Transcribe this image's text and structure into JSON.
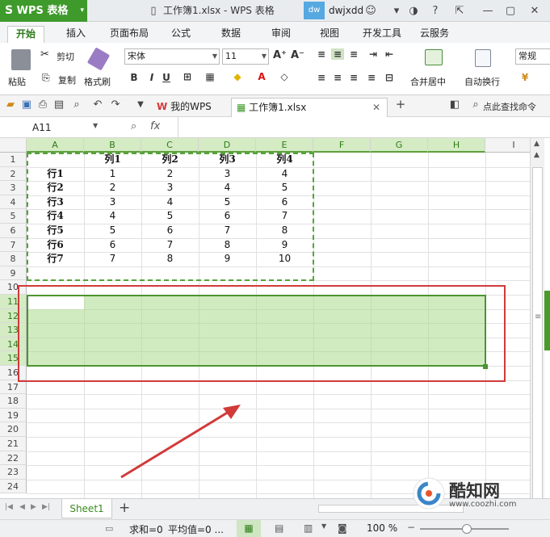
{
  "titlebar": {
    "app_label": "WPS 表格",
    "doc_title": "工作簿1.xlsx - WPS 表格",
    "avatar_text": "dw",
    "user_name": "dwjxdd"
  },
  "ribbon_tabs": [
    "开始",
    "插入",
    "页面布局",
    "公式",
    "数据",
    "审阅",
    "视图",
    "开发工具",
    "云服务"
  ],
  "ribbon": {
    "cut": "剪切",
    "paste": "粘贴",
    "copy": "复制",
    "format_painter": "格式刷",
    "font_name": "宋体",
    "font_size": "11",
    "merge_center": "合并居中",
    "wrap_text": "自动换行",
    "normal": "常规",
    "bold": "B",
    "italic": "I",
    "underline": "U"
  },
  "doc_tabs": {
    "wps_tab": "我的WPS",
    "file_tab": "工作簿1.xlsx",
    "search": "点此查找命令"
  },
  "formula_bar": {
    "name_box": "A11",
    "fx": "fx"
  },
  "columns": [
    "A",
    "B",
    "C",
    "D",
    "E",
    "F",
    "G",
    "H",
    "I"
  ],
  "rows": [
    "1",
    "2",
    "3",
    "4",
    "5",
    "6",
    "7",
    "8",
    "9",
    "10",
    "11",
    "12",
    "13",
    "14",
    "15",
    "16",
    "17",
    "18",
    "19",
    "20",
    "21",
    "22",
    "23",
    "24"
  ],
  "table": {
    "headers": [
      "列1",
      "列2",
      "列3",
      "列4"
    ],
    "rows": [
      {
        "label": "行1",
        "values": [
          "1",
          "2",
          "3",
          "4"
        ]
      },
      {
        "label": "行2",
        "values": [
          "2",
          "3",
          "4",
          "5"
        ]
      },
      {
        "label": "行3",
        "values": [
          "3",
          "4",
          "5",
          "6"
        ]
      },
      {
        "label": "行4",
        "values": [
          "4",
          "5",
          "6",
          "7"
        ]
      },
      {
        "label": "行5",
        "values": [
          "5",
          "6",
          "7",
          "8"
        ]
      },
      {
        "label": "行6",
        "values": [
          "6",
          "7",
          "8",
          "9"
        ]
      },
      {
        "label": "行7",
        "values": [
          "7",
          "8",
          "9",
          "10"
        ]
      }
    ]
  },
  "sheets": {
    "active": "Sheet1",
    "add": "+"
  },
  "status": {
    "sum": "求和=0",
    "avg": "平均值=0 ...",
    "zoom": "100 %"
  },
  "watermark": {
    "brand": "酷知网",
    "url": "www.coozhi.com"
  },
  "colors": {
    "accent": "#3f9a2c",
    "selection": "#acda8c",
    "annotation": "#d23a3a"
  }
}
